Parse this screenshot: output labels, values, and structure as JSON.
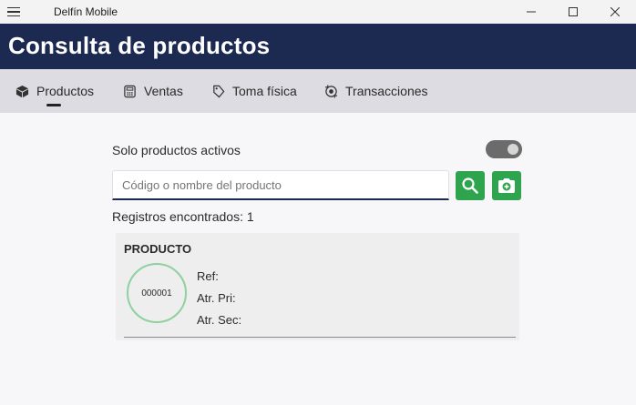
{
  "window": {
    "title": "Delfín Mobile"
  },
  "header": {
    "title": "Consulta de productos"
  },
  "tabs": [
    {
      "label": "Productos",
      "icon": "box-icon",
      "selected": true
    },
    {
      "label": "Ventas",
      "icon": "register-icon",
      "selected": false
    },
    {
      "label": "Toma física",
      "icon": "tag-icon",
      "selected": false
    },
    {
      "label": "Transacciones",
      "icon": "exchange-icon",
      "selected": false
    }
  ],
  "filters": {
    "active_only_label": "Solo productos activos",
    "active_only_value": true
  },
  "search": {
    "value": "",
    "placeholder": "Código o nombre del producto"
  },
  "results": {
    "label": "Registros encontrados: 1"
  },
  "product": {
    "title": "PRODUCTO",
    "code": "000001",
    "ref_label": "Ref:",
    "attr_primary_label": "Atr. Pri:",
    "attr_secondary_label": "Atr. Sec:"
  },
  "colors": {
    "header_bg": "#1c2a52",
    "accent_green": "#2ea44f",
    "circle_border": "#8fd19e"
  }
}
